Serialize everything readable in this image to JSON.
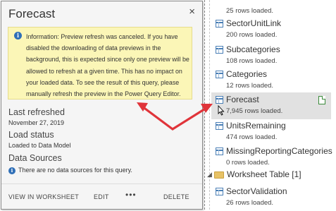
{
  "card": {
    "title": "Forecast",
    "close_glyph": "×",
    "info": {
      "icon": "info-icon",
      "text": "Information: Preview refresh was canceled. If you have disabled the downloading of data previews in the background, this is expected since only one preview will be allowed to refresh at a given time. This has no impact on your loaded data. To see the result of this query, please manually refresh the preview in the Power Query Editor."
    },
    "last_refreshed": {
      "label": "Last refreshed",
      "value": "November 27, 2019"
    },
    "load_status": {
      "label": "Load status",
      "value": "Loaded to Data Model"
    },
    "data_sources": {
      "label": "Data Sources",
      "value": "There are no data sources for this query."
    },
    "footer": {
      "view_label": "VIEW IN WORKSHEET",
      "edit_label": "EDIT",
      "more_label": "•••",
      "delete_label": "DELETE"
    }
  },
  "pane": {
    "top_rows": "25 rows loaded.",
    "queries": [
      {
        "name": "SectorUnitLink",
        "rows": "200 rows loaded."
      },
      {
        "name": "Subcategories",
        "rows": "108 rows loaded."
      },
      {
        "name": "Categories",
        "rows": "12 rows loaded."
      },
      {
        "name": "Forecast",
        "rows": "7,945 rows loaded.",
        "selected": true
      },
      {
        "name": "UnitsRemaining",
        "rows": "474 rows loaded."
      },
      {
        "name": "MissingReportingCategories",
        "rows": "0 rows loaded."
      }
    ],
    "group": {
      "label": "Worksheet Table",
      "count": "[1]"
    },
    "group_queries": [
      {
        "name": "SectorValidation",
        "rows": "26 rows loaded."
      }
    ]
  },
  "colors": {
    "info_bg": "#fbf6b7",
    "arrow": "#e0343a",
    "accent": "#2f6fb7"
  }
}
